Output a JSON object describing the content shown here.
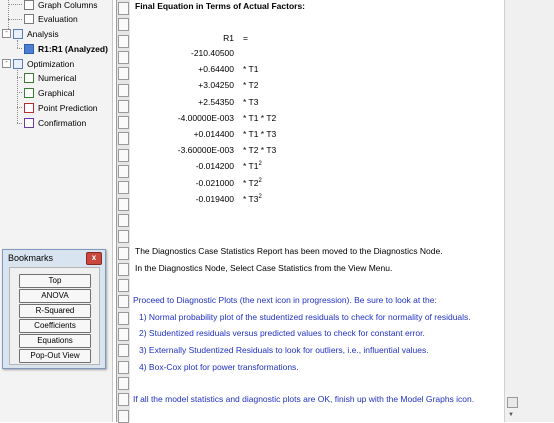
{
  "tree": {
    "items": [
      {
        "label": "Graph Columns"
      },
      {
        "label": "Evaluation"
      },
      {
        "label": "Analysis"
      },
      {
        "label": "R1:R1 (Analyzed)"
      },
      {
        "label": "Optimization"
      },
      {
        "label": "Numerical"
      },
      {
        "label": "Graphical"
      },
      {
        "label": "Point Prediction"
      },
      {
        "label": "Confirmation"
      }
    ],
    "collapse_glyph": "-"
  },
  "bookmarks": {
    "title": "Bookmarks",
    "close_glyph": "x",
    "buttons": [
      "Top",
      "ANOVA",
      "R-Squared",
      "Coefficients",
      "Equations",
      "Pop-Out View"
    ]
  },
  "report": {
    "heading": "Final Equation in Terms of Actual Factors:",
    "response": "R1",
    "equals": "=",
    "rows": [
      {
        "coef": "-210.40500",
        "term": ""
      },
      {
        "coef": "+0.64400",
        "term": "* T1"
      },
      {
        "coef": "+3.04250",
        "term": "* T2"
      },
      {
        "coef": "+2.54350",
        "term": "* T3"
      },
      {
        "coef": "-4.00000E-003",
        "term": "* T1 * T2"
      },
      {
        "coef": "+0.014400",
        "term": "* T1 * T3"
      },
      {
        "coef": "-3.60000E-003",
        "term": "* T2 * T3"
      },
      {
        "coef": "-0.014200",
        "term": "* T1",
        "sup": "2"
      },
      {
        "coef": "-0.021000",
        "term": "* T2",
        "sup": "2"
      },
      {
        "coef": "-0.019400",
        "term": "* T3",
        "sup": "2"
      }
    ],
    "diag_note_1": "The Diagnostics Case Statistics Report has been moved to the Diagnostics Node.",
    "diag_note_2": "In the Diagnostics Node, Select Case Statistics from the View Menu.",
    "proceed": "Proceed to Diagnostic Plots (the next icon in progression).  Be sure to look at the:",
    "list": [
      "1) Normal probability plot of the studentized residuals to check for normality of residuals.",
      "2) Studentized residuals versus predicted values to check for constant error.",
      "3) Externally Studentized Residuals to look for outliers, i.e., influential values.",
      "4) Box-Cox plot for power transformations."
    ],
    "final": "If all the model statistics and diagnostic plots are OK, finish up with the Model Graphs icon."
  },
  "colors": {
    "blue_text": "#2132c4",
    "close_button": "#c9473c",
    "bookmarks_frame": "#d9e4f1"
  }
}
